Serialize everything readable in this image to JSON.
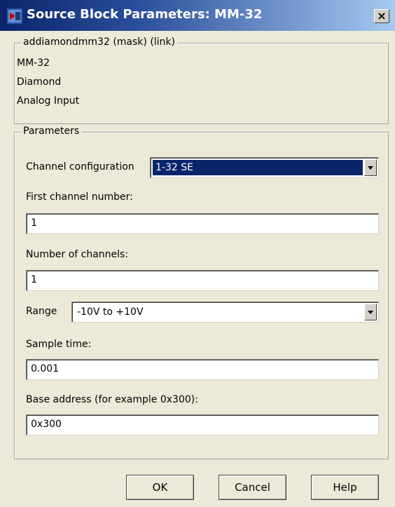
{
  "window": {
    "title": "Source Block Parameters: MM-32",
    "close_label": "×"
  },
  "description": {
    "group_title": "addiamondmm32 (mask) (link)",
    "lines": [
      "MM-32",
      "Diamond",
      "Analog Input"
    ]
  },
  "parameters": {
    "group_title": "Parameters",
    "channel_configuration": {
      "label": "Channel configuration",
      "value": "1-32 SE"
    },
    "first_channel_number": {
      "label": "First channel number:",
      "value": "1"
    },
    "number_of_channels": {
      "label": "Number of channels:",
      "value": "1"
    },
    "range": {
      "label": "Range",
      "value": "-10V to +10V"
    },
    "sample_time": {
      "label": "Sample time:",
      "value": "0.001"
    },
    "base_address": {
      "label": "Base address (for example 0x300):",
      "value": "0x300"
    }
  },
  "buttons": {
    "ok": "OK",
    "cancel": "Cancel",
    "help": "Help"
  },
  "icons": {
    "app": "simulink-block-icon",
    "close": "close-icon",
    "dropdown": "chevron-down-icon"
  }
}
